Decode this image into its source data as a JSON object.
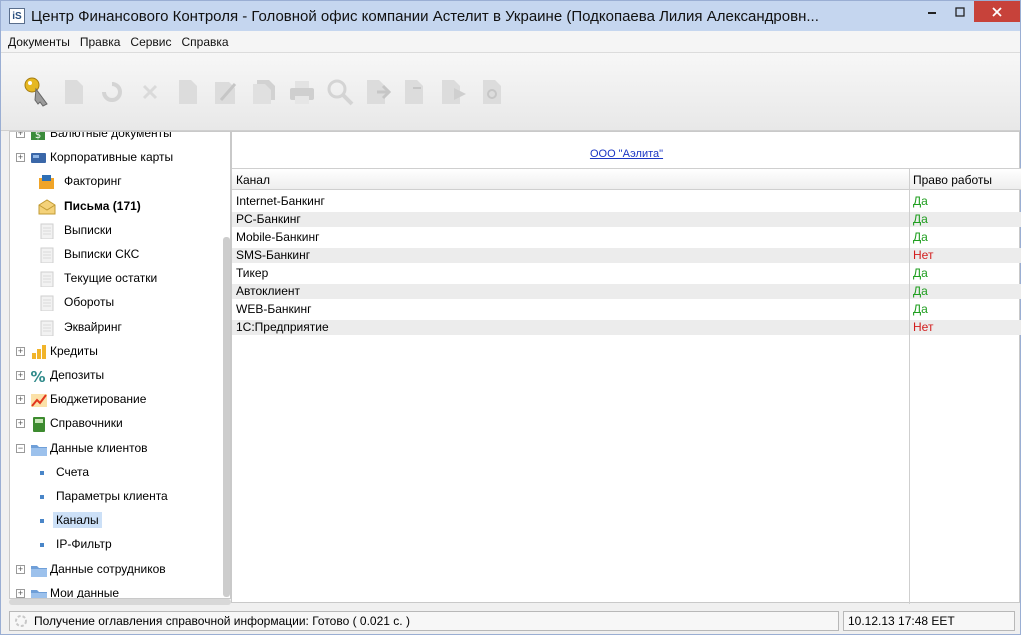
{
  "window": {
    "title": "Центр Финансового Контроля - Головной офис компании Астелит в Украине (Подкопаева Лилия Александровн...",
    "icon_text": "iS"
  },
  "menu": [
    "Документы",
    "Правка",
    "Сервис",
    "Справка"
  ],
  "sidebar": {
    "items": [
      {
        "label": "Валютные документы",
        "level": 0,
        "expander": "+",
        "icon": "currency-doc-icon"
      },
      {
        "label": "Корпоративные карты",
        "level": 0,
        "expander": "+",
        "icon": "corporate-cards-icon"
      },
      {
        "label": "Факторинг",
        "level": 1,
        "icon": "factoring-icon"
      },
      {
        "label": "Письма (171)",
        "level": 1,
        "icon": "mail-icon",
        "bold": true
      },
      {
        "label": "Выписки",
        "level": 1,
        "icon": "statement-icon"
      },
      {
        "label": "Выписки СКС",
        "level": 1,
        "icon": "statement-icon"
      },
      {
        "label": "Текущие остатки",
        "level": 1,
        "icon": "statement-icon"
      },
      {
        "label": "Обороты",
        "level": 1,
        "icon": "statement-icon"
      },
      {
        "label": "Эквайринг",
        "level": 1,
        "icon": "statement-icon"
      },
      {
        "label": "Кредиты",
        "level": 0,
        "expander": "+",
        "icon": "credits-icon"
      },
      {
        "label": "Депозиты",
        "level": 0,
        "expander": "+",
        "icon": "percent-icon"
      },
      {
        "label": "Бюджетирование",
        "level": 0,
        "expander": "+",
        "icon": "budget-icon"
      },
      {
        "label": "Справочники",
        "level": 0,
        "expander": "+",
        "icon": "reference-book-icon"
      },
      {
        "label": "Данные клиентов",
        "level": 0,
        "expander": "−",
        "icon": "folder-icon"
      },
      {
        "label": "Счета",
        "level": 2
      },
      {
        "label": "Параметры клиента",
        "level": 2
      },
      {
        "label": "Каналы",
        "level": 2,
        "selected": true
      },
      {
        "label": "IP-Фильтр",
        "level": 2
      },
      {
        "label": "Данные сотрудников",
        "level": 0,
        "expander": "+",
        "icon": "folder-icon"
      },
      {
        "label": "Мои данные",
        "level": 0,
        "expander": "+",
        "icon": "folder-icon"
      }
    ]
  },
  "main": {
    "company": "ООО \"Аэлита\"",
    "columns": [
      "Канал",
      "Право работы"
    ],
    "rows": [
      {
        "channel": "Internet-Банкинг",
        "right": "Да"
      },
      {
        "channel": "PC-Банкинг",
        "right": "Да"
      },
      {
        "channel": "Mobile-Банкинг",
        "right": "Да"
      },
      {
        "channel": "SMS-Банкинг",
        "right": "Нет"
      },
      {
        "channel": "Тикер",
        "right": "Да"
      },
      {
        "channel": "Автоклиент",
        "right": "Да"
      },
      {
        "channel": "WEB-Банкинг",
        "right": "Да"
      },
      {
        "channel": "1С:Предприятие",
        "right": "Нет"
      }
    ]
  },
  "status": {
    "message": "Получение оглавления справочной информации: Готово ( 0.021 с. )",
    "time": "10.12.13 17:48 EET"
  },
  "colors": {
    "yes": "#1e9e1e",
    "no": "#d21d1d",
    "link": "#1a35c4",
    "close": "#c7423a",
    "selected": "#cce0f7"
  }
}
